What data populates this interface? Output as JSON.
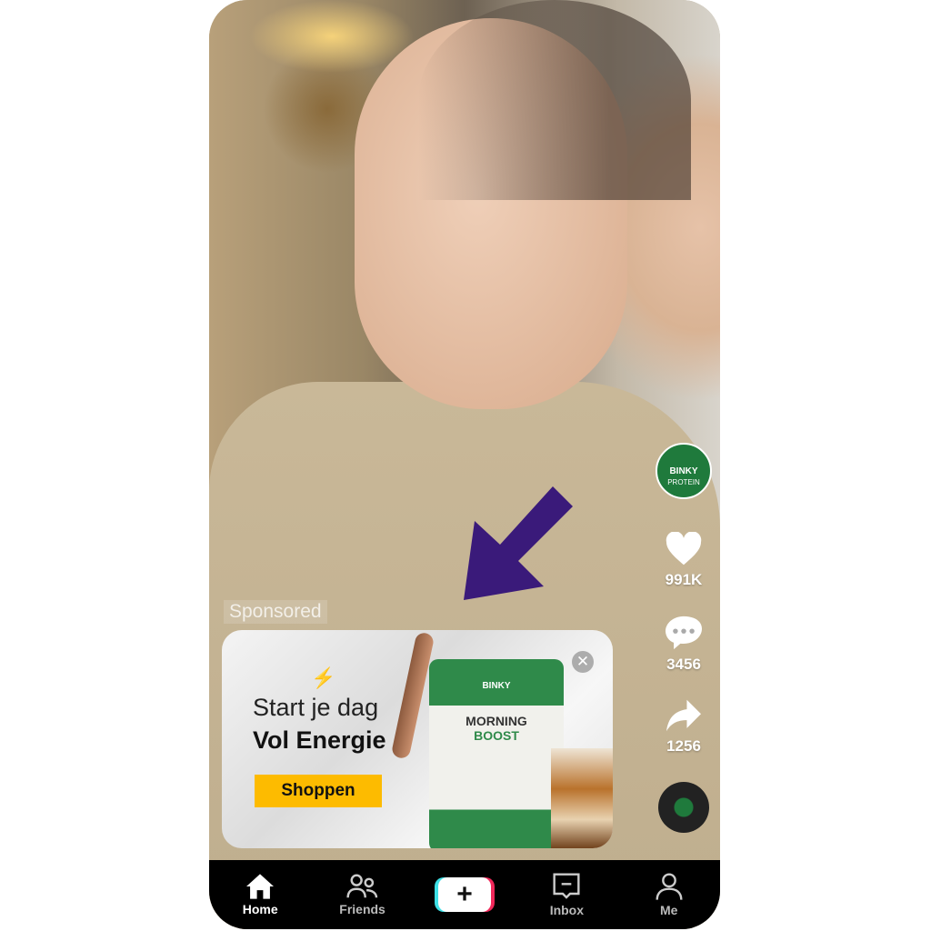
{
  "ad": {
    "sponsored_label": "Sponsored",
    "headline_1": "Start je dag",
    "headline_2": "Vol Energie",
    "cta": "Shoppen",
    "product_brand": "BINKY",
    "product_name_1": "MORNING",
    "product_name_2": "BOOST",
    "cta_color": "#fdbb00"
  },
  "creator": {
    "avatar_text_1": "BINKY",
    "avatar_text_2": "PROTEIN"
  },
  "actions": {
    "likes": "991K",
    "comments": "3456",
    "shares": "1256"
  },
  "nav": {
    "items": [
      {
        "label": "Home",
        "icon": "home-icon"
      },
      {
        "label": "Friends",
        "icon": "friends-icon"
      },
      {
        "label": "",
        "icon": "plus-icon"
      },
      {
        "label": "Inbox",
        "icon": "inbox-icon"
      },
      {
        "label": "Me",
        "icon": "profile-icon"
      }
    ]
  },
  "colors": {
    "arrow": "#3a1a7a",
    "brand_green": "#2f8a4a"
  }
}
